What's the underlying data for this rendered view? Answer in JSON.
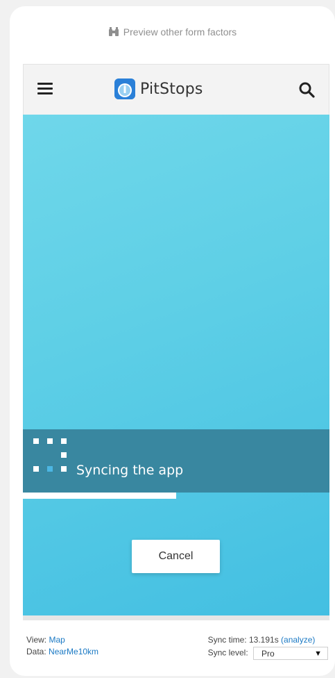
{
  "preview": {
    "label": "Preview other form factors",
    "icon": "binoculars-icon"
  },
  "appbar": {
    "title": "PitStops",
    "menu_icon": "hamburger-menu-icon",
    "search_icon": "search-icon",
    "logo_icon": "app-logo-icon"
  },
  "sync": {
    "label": "Syncing the app",
    "progress": 0.5,
    "cancel_label": "Cancel"
  },
  "footer": {
    "view_label": "View:",
    "view_value": "Map",
    "data_label": "Data:",
    "data_value": "NearMe10km",
    "sync_time_label": "Sync time:",
    "sync_time_value": "13.191s",
    "analyze_label": "(analyze)",
    "sync_level_label": "Sync level:",
    "sync_level_value": "Pro"
  },
  "colors": {
    "accent_blue": "#1a79c4",
    "band": "#3987a0",
    "gradient_start": "#6fd7ea",
    "gradient_end": "#43bfe2"
  }
}
